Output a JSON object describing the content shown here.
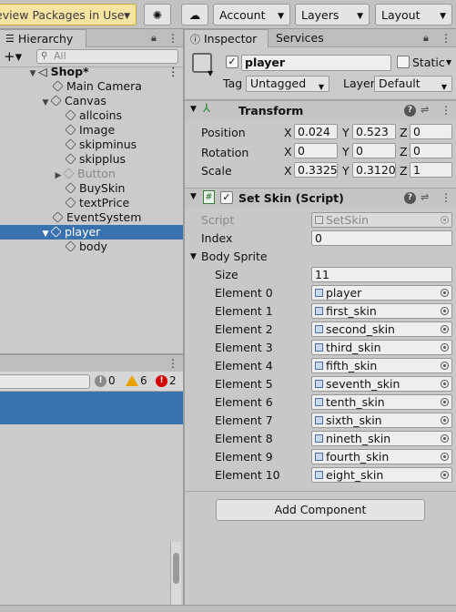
{
  "toolbar": {
    "packages_label": "eview Packages in Use",
    "account_label": "Account",
    "layers_label": "Layers",
    "layout_label": "Layout"
  },
  "hierarchy": {
    "tab_label": "Hierarchy",
    "search_placeholder": "All",
    "items": [
      {
        "label": "Shop*"
      },
      {
        "label": "Main Camera"
      },
      {
        "label": "Canvas"
      },
      {
        "label": "allcoins"
      },
      {
        "label": "Image"
      },
      {
        "label": "skipminus"
      },
      {
        "label": "skipplus"
      },
      {
        "label": "Button"
      },
      {
        "label": "BuySkin"
      },
      {
        "label": "textPrice"
      },
      {
        "label": "EventSystem"
      },
      {
        "label": "player"
      },
      {
        "label": "body"
      }
    ]
  },
  "console": {
    "info_count": "0",
    "warning_count": "6",
    "error_count": "2"
  },
  "inspector": {
    "tab_label": "Inspector",
    "services_tab_label": "Services",
    "object_name": "player",
    "static_label": "Static",
    "tag_label": "Tag",
    "tag_value": "Untagged",
    "layer_label": "Layer",
    "layer_value": "Default",
    "transform": {
      "title": "Transform",
      "position_label": "Position",
      "rotation_label": "Rotation",
      "scale_label": "Scale",
      "axis_x": "X",
      "axis_y": "Y",
      "axis_z": "Z",
      "position": {
        "x": "0.024",
        "y": "0.523",
        "z": "0"
      },
      "rotation": {
        "x": "0",
        "y": "0",
        "z": "0"
      },
      "scale": {
        "x": "0.3325",
        "y": "0.3120",
        "z": "1"
      }
    },
    "setskin": {
      "title": "Set Skin (Script)",
      "script_label": "Script",
      "script_value": "SetSkin",
      "index_label": "Index",
      "index_value": "0",
      "body_sprite_label": "Body Sprite",
      "size_label": "Size",
      "size_value": "11",
      "elements": [
        {
          "label": "Element 0",
          "value": "player"
        },
        {
          "label": "Element 1",
          "value": "first_skin"
        },
        {
          "label": "Element 2",
          "value": "second_skin"
        },
        {
          "label": "Element 3",
          "value": "third_skin"
        },
        {
          "label": "Element 4",
          "value": "fifth_skin"
        },
        {
          "label": "Element 5",
          "value": "seventh_skin"
        },
        {
          "label": "Element 6",
          "value": "tenth_skin"
        },
        {
          "label": "Element 7",
          "value": "sixth_skin"
        },
        {
          "label": "Element 8",
          "value": "nineth_skin"
        },
        {
          "label": "Element 9",
          "value": "fourth_skin"
        },
        {
          "label": "Element 10",
          "value": "eight_skin"
        }
      ]
    },
    "add_component_label": "Add Component"
  }
}
